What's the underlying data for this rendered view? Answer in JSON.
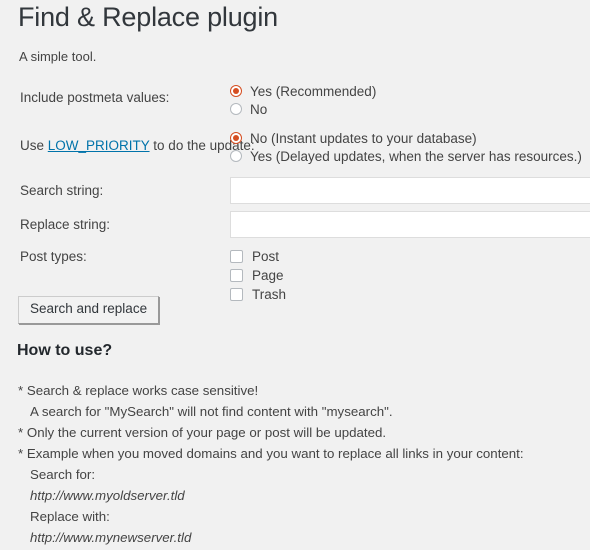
{
  "header": {
    "title": "Find & Replace plugin",
    "subtitle": "A simple tool."
  },
  "form": {
    "postmeta": {
      "label": "Include postmeta values:",
      "options": [
        {
          "label": "Yes (Recommended)",
          "checked": true
        },
        {
          "label": "No",
          "checked": false
        }
      ]
    },
    "low_priority": {
      "label_prefix": "Use ",
      "label_link": "LOW_PRIORITY",
      "label_suffix": " to do the update:",
      "options": [
        {
          "label": "No (Instant updates to your database)",
          "checked": true
        },
        {
          "label": "Yes (Delayed updates, when the server has resources.)",
          "checked": false
        }
      ]
    },
    "search_string": {
      "label": "Search string:",
      "value": "",
      "placeholder": ""
    },
    "replace_string": {
      "label": "Replace string:",
      "value": "",
      "placeholder": ""
    },
    "post_types": {
      "label": "Post types:",
      "options": [
        {
          "label": "Post",
          "checked": false
        },
        {
          "label": "Page",
          "checked": false
        },
        {
          "label": "Trash",
          "checked": false
        }
      ]
    },
    "submit_label": "Search and replace"
  },
  "howto": {
    "title": "How to use?",
    "lines": [
      {
        "text": "* Search & replace works case sensitive!",
        "style": "normal"
      },
      {
        "text": "A search for \"MySearch\" will not find content with \"mysearch\".",
        "style": "indent"
      },
      {
        "text": "* Only the current version of your page or post will be updated.",
        "style": "normal"
      },
      {
        "text": "* Example when you moved domains and you want to replace all links in your content:",
        "style": "normal"
      },
      {
        "text": "Search for:",
        "style": "indent"
      },
      {
        "text": "http://www.myoldserver.tld",
        "style": "url"
      },
      {
        "text": "Replace with:",
        "style": "indent"
      },
      {
        "text": "http://www.mynewserver.tld",
        "style": "url"
      }
    ]
  },
  "colors": {
    "background": "#f1f1f1",
    "accent_radio": "#d54e21",
    "link": "#0073aa",
    "title": "#32373c",
    "text": "#444444"
  }
}
